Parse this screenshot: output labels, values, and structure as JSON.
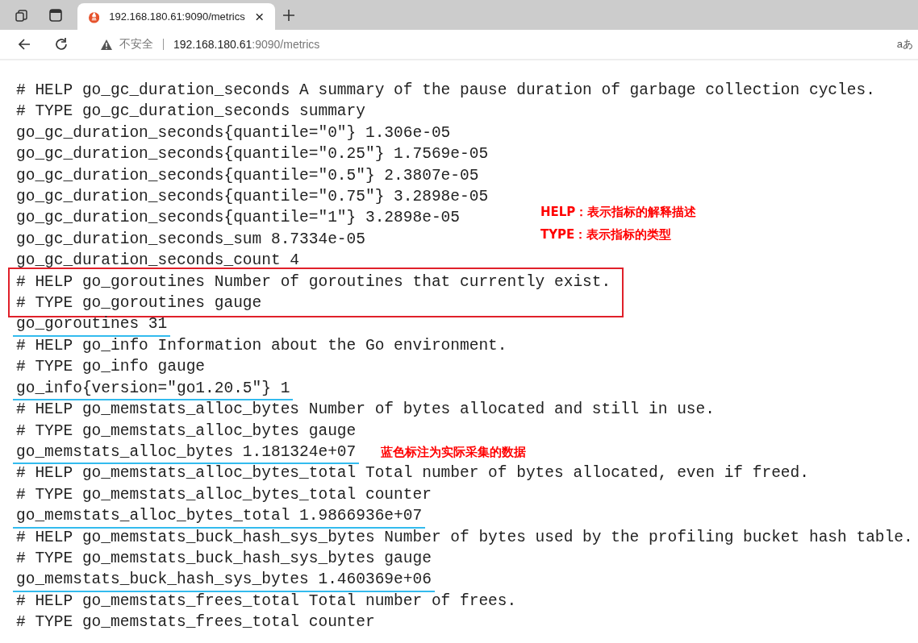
{
  "browser": {
    "tabs": [
      {
        "title": "192.168.180.61:9090/metrics",
        "selected": true
      }
    ],
    "address": {
      "security": "不安全",
      "host": "192.168.180.61",
      "path": ":9090/metrics"
    },
    "reader_label": "aあ"
  },
  "blocks": [
    {
      "kind": "plain",
      "lines": [
        {
          "text": "# HELP go_gc_duration_seconds A summary of the pause duration of garbage collection cycles.",
          "underlined": false
        },
        {
          "text": "# TYPE go_gc_duration_seconds summary",
          "underlined": false
        },
        {
          "text": "go_gc_duration_seconds{quantile=\"0\"} 1.306e-05",
          "underlined": false
        },
        {
          "text": "go_gc_duration_seconds{quantile=\"0.25\"} 1.7569e-05",
          "underlined": false
        },
        {
          "text": "go_gc_duration_seconds{quantile=\"0.5\"} 2.3807e-05",
          "underlined": false
        },
        {
          "text": "go_gc_duration_seconds{quantile=\"0.75\"} 3.2898e-05",
          "underlined": false
        },
        {
          "text": "go_gc_duration_seconds{quantile=\"1\"} 3.2898e-05",
          "underlined": false
        },
        {
          "text": "go_gc_duration_seconds_sum 8.7334e-05",
          "underlined": false
        },
        {
          "text": "go_gc_duration_seconds_count 4",
          "underlined": false
        }
      ]
    },
    {
      "kind": "boxed",
      "lines": [
        {
          "text": "# HELP go_goroutines Number of goroutines that currently exist.",
          "underlined": false
        },
        {
          "text": "# TYPE go_goroutines gauge",
          "underlined": false
        }
      ]
    },
    {
      "kind": "plain",
      "lines": [
        {
          "text": "go_goroutines 31",
          "underlined": true
        },
        {
          "text": "# HELP go_info Information about the Go environment.",
          "underlined": false
        },
        {
          "text": "# TYPE go_info gauge",
          "underlined": false
        },
        {
          "text": "go_info{version=\"go1.20.5\"} 1",
          "underlined": true
        },
        {
          "text": "# HELP go_memstats_alloc_bytes Number of bytes allocated and still in use.",
          "underlined": false
        },
        {
          "text": "# TYPE go_memstats_alloc_bytes gauge",
          "underlined": false
        },
        {
          "text": "go_memstats_alloc_bytes 1.181324e+07",
          "underlined": true
        },
        {
          "text": "# HELP go_memstats_alloc_bytes_total Total number of bytes allocated, even if freed.",
          "underlined": false
        },
        {
          "text": "# TYPE go_memstats_alloc_bytes_total counter",
          "underlined": false
        },
        {
          "text": "go_memstats_alloc_bytes_total 1.9866936e+07",
          "underlined": true
        },
        {
          "text": "# HELP go_memstats_buck_hash_sys_bytes Number of bytes used by the profiling bucket hash table.",
          "underlined": false
        },
        {
          "text": "# TYPE go_memstats_buck_hash_sys_bytes gauge",
          "underlined": false
        },
        {
          "text": "go_memstats_buck_hash_sys_bytes 1.460369e+06",
          "underlined": true
        },
        {
          "text": "# HELP go_memstats_frees_total Total number of frees.",
          "underlined": false
        },
        {
          "text": "# TYPE go_memstats_frees_total counter",
          "underlined": false
        }
      ]
    }
  ],
  "annotations": [
    {
      "kind": "legend",
      "texts": [
        "HELP：表示指标的解释描述",
        "TYPE：表示指标的类型"
      ]
    },
    {
      "kind": "callout",
      "texts": [
        "蓝色标注为实际采集的数据"
      ]
    }
  ]
}
